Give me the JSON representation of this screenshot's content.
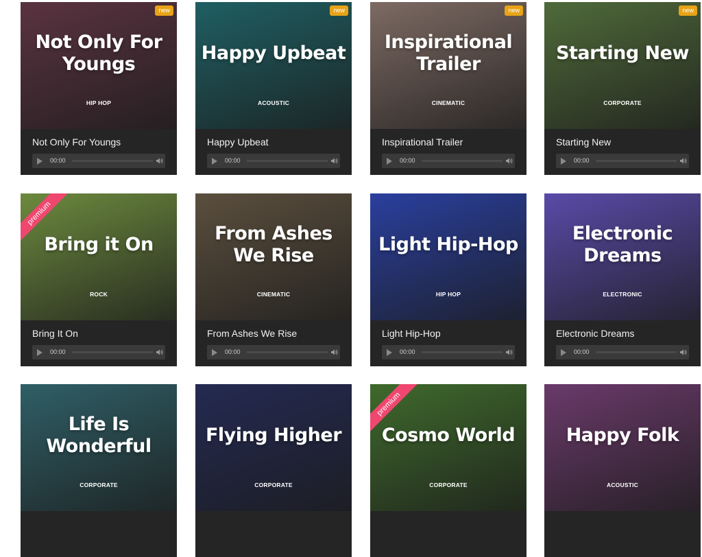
{
  "colors": {
    "card_bg": "#252525",
    "player_bg": "#3a3a3a",
    "new_badge": "#e8a317",
    "premium_ribbon": "#ef476f"
  },
  "cards": [
    {
      "cover_title": "Not Only For Youngs",
      "genre": "HIP HOP",
      "badge": "new",
      "track_title": "Not Only For Youngs",
      "time": "00:00",
      "tint": "#5a3340"
    },
    {
      "cover_title": "Happy Upbeat",
      "genre": "ACOUSTIC",
      "badge": "new",
      "track_title": "Happy Upbeat",
      "time": "00:00",
      "tint": "#1f5f63"
    },
    {
      "cover_title": "Inspirational Trailer",
      "genre": "CINEMATIC",
      "badge": "new",
      "track_title": "Inspirational Trailer",
      "time": "00:00",
      "tint": "#7d6a63"
    },
    {
      "cover_title": "Starting New",
      "genre": "CORPORATE",
      "badge": "new",
      "track_title": "Starting New",
      "time": "00:00",
      "tint": "#4f6a3a"
    },
    {
      "cover_title": "Bring it On",
      "genre": "ROCK",
      "ribbon": "premium",
      "track_title": "Bring It On",
      "time": "00:00",
      "tint": "#6c8a3e"
    },
    {
      "cover_title": "From Ashes We Rise",
      "genre": "CINEMATIC",
      "track_title": "From Ashes We Rise",
      "time": "00:00",
      "tint": "#5b4f3e"
    },
    {
      "cover_title": "Light Hip-Hop",
      "genre": "HIP HOP",
      "track_title": "Light Hip-Hop",
      "time": "00:00",
      "tint": "#2a3f9e"
    },
    {
      "cover_title": "Electronic Dreams",
      "genre": "ELECTRONIC",
      "track_title": "Electronic Dreams",
      "time": "00:00",
      "tint": "#5a4aa8"
    },
    {
      "cover_title": "Life Is Wonderful",
      "genre": "CORPORATE",
      "track_title": "",
      "time": "",
      "tint": "#2f5f66"
    },
    {
      "cover_title": "Flying Higher",
      "genre": "CORPORATE",
      "track_title": "",
      "time": "",
      "tint": "#242a52"
    },
    {
      "cover_title": "Cosmo World",
      "genre": "CORPORATE",
      "ribbon": "premium",
      "track_title": "",
      "time": "",
      "tint": "#3f6a2c"
    },
    {
      "cover_title": "Happy Folk",
      "genre": "ACOUSTIC",
      "track_title": "",
      "time": "",
      "tint": "#6a3a6a"
    }
  ]
}
